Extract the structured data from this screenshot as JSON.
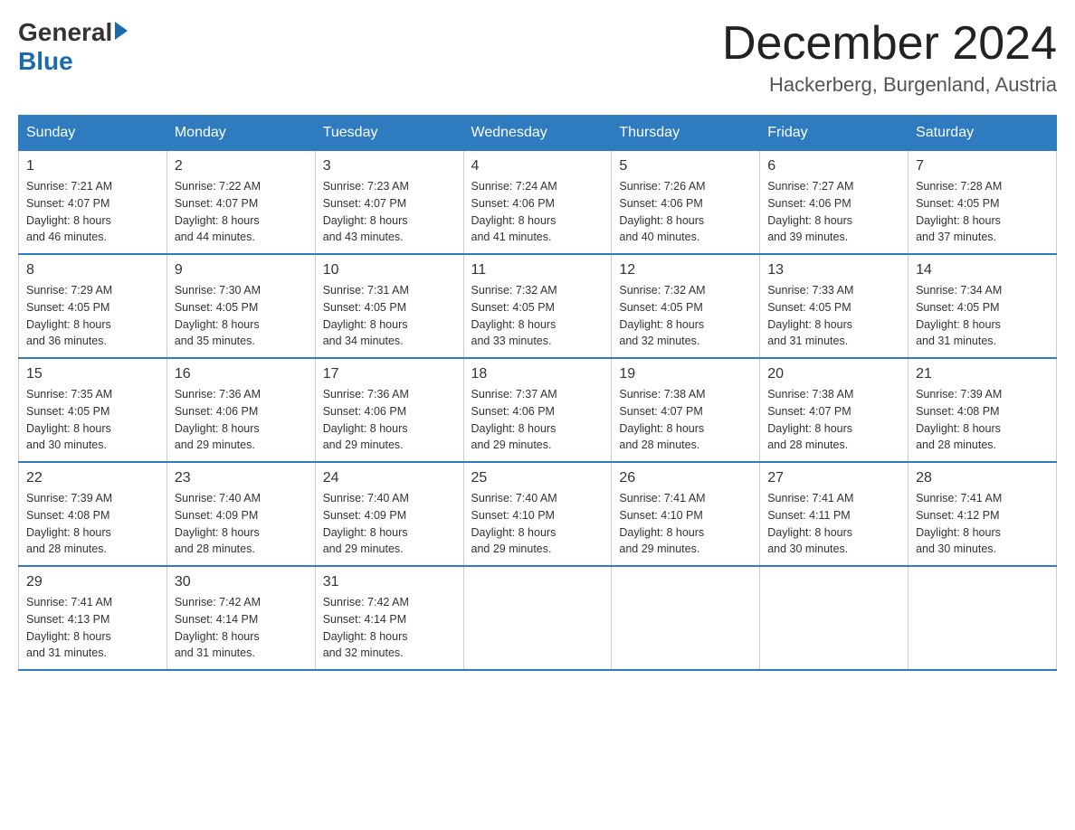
{
  "header": {
    "logo_general": "General",
    "logo_blue": "Blue",
    "month_year": "December 2024",
    "location": "Hackerberg, Burgenland, Austria"
  },
  "days_of_week": [
    "Sunday",
    "Monday",
    "Tuesday",
    "Wednesday",
    "Thursday",
    "Friday",
    "Saturday"
  ],
  "weeks": [
    [
      {
        "day": "1",
        "sunrise": "7:21 AM",
        "sunset": "4:07 PM",
        "daylight": "8 hours and 46 minutes."
      },
      {
        "day": "2",
        "sunrise": "7:22 AM",
        "sunset": "4:07 PM",
        "daylight": "8 hours and 44 minutes."
      },
      {
        "day": "3",
        "sunrise": "7:23 AM",
        "sunset": "4:07 PM",
        "daylight": "8 hours and 43 minutes."
      },
      {
        "day": "4",
        "sunrise": "7:24 AM",
        "sunset": "4:06 PM",
        "daylight": "8 hours and 41 minutes."
      },
      {
        "day": "5",
        "sunrise": "7:26 AM",
        "sunset": "4:06 PM",
        "daylight": "8 hours and 40 minutes."
      },
      {
        "day": "6",
        "sunrise": "7:27 AM",
        "sunset": "4:06 PM",
        "daylight": "8 hours and 39 minutes."
      },
      {
        "day": "7",
        "sunrise": "7:28 AM",
        "sunset": "4:05 PM",
        "daylight": "8 hours and 37 minutes."
      }
    ],
    [
      {
        "day": "8",
        "sunrise": "7:29 AM",
        "sunset": "4:05 PM",
        "daylight": "8 hours and 36 minutes."
      },
      {
        "day": "9",
        "sunrise": "7:30 AM",
        "sunset": "4:05 PM",
        "daylight": "8 hours and 35 minutes."
      },
      {
        "day": "10",
        "sunrise": "7:31 AM",
        "sunset": "4:05 PM",
        "daylight": "8 hours and 34 minutes."
      },
      {
        "day": "11",
        "sunrise": "7:32 AM",
        "sunset": "4:05 PM",
        "daylight": "8 hours and 33 minutes."
      },
      {
        "day": "12",
        "sunrise": "7:32 AM",
        "sunset": "4:05 PM",
        "daylight": "8 hours and 32 minutes."
      },
      {
        "day": "13",
        "sunrise": "7:33 AM",
        "sunset": "4:05 PM",
        "daylight": "8 hours and 31 minutes."
      },
      {
        "day": "14",
        "sunrise": "7:34 AM",
        "sunset": "4:05 PM",
        "daylight": "8 hours and 31 minutes."
      }
    ],
    [
      {
        "day": "15",
        "sunrise": "7:35 AM",
        "sunset": "4:05 PM",
        "daylight": "8 hours and 30 minutes."
      },
      {
        "day": "16",
        "sunrise": "7:36 AM",
        "sunset": "4:06 PM",
        "daylight": "8 hours and 29 minutes."
      },
      {
        "day": "17",
        "sunrise": "7:36 AM",
        "sunset": "4:06 PM",
        "daylight": "8 hours and 29 minutes."
      },
      {
        "day": "18",
        "sunrise": "7:37 AM",
        "sunset": "4:06 PM",
        "daylight": "8 hours and 29 minutes."
      },
      {
        "day": "19",
        "sunrise": "7:38 AM",
        "sunset": "4:07 PM",
        "daylight": "8 hours and 28 minutes."
      },
      {
        "day": "20",
        "sunrise": "7:38 AM",
        "sunset": "4:07 PM",
        "daylight": "8 hours and 28 minutes."
      },
      {
        "day": "21",
        "sunrise": "7:39 AM",
        "sunset": "4:08 PM",
        "daylight": "8 hours and 28 minutes."
      }
    ],
    [
      {
        "day": "22",
        "sunrise": "7:39 AM",
        "sunset": "4:08 PM",
        "daylight": "8 hours and 28 minutes."
      },
      {
        "day": "23",
        "sunrise": "7:40 AM",
        "sunset": "4:09 PM",
        "daylight": "8 hours and 28 minutes."
      },
      {
        "day": "24",
        "sunrise": "7:40 AM",
        "sunset": "4:09 PM",
        "daylight": "8 hours and 29 minutes."
      },
      {
        "day": "25",
        "sunrise": "7:40 AM",
        "sunset": "4:10 PM",
        "daylight": "8 hours and 29 minutes."
      },
      {
        "day": "26",
        "sunrise": "7:41 AM",
        "sunset": "4:10 PM",
        "daylight": "8 hours and 29 minutes."
      },
      {
        "day": "27",
        "sunrise": "7:41 AM",
        "sunset": "4:11 PM",
        "daylight": "8 hours and 30 minutes."
      },
      {
        "day": "28",
        "sunrise": "7:41 AM",
        "sunset": "4:12 PM",
        "daylight": "8 hours and 30 minutes."
      }
    ],
    [
      {
        "day": "29",
        "sunrise": "7:41 AM",
        "sunset": "4:13 PM",
        "daylight": "8 hours and 31 minutes."
      },
      {
        "day": "30",
        "sunrise": "7:42 AM",
        "sunset": "4:14 PM",
        "daylight": "8 hours and 31 minutes."
      },
      {
        "day": "31",
        "sunrise": "7:42 AM",
        "sunset": "4:14 PM",
        "daylight": "8 hours and 32 minutes."
      },
      null,
      null,
      null,
      null
    ]
  ],
  "labels": {
    "sunrise": "Sunrise:",
    "sunset": "Sunset:",
    "daylight": "Daylight:"
  }
}
